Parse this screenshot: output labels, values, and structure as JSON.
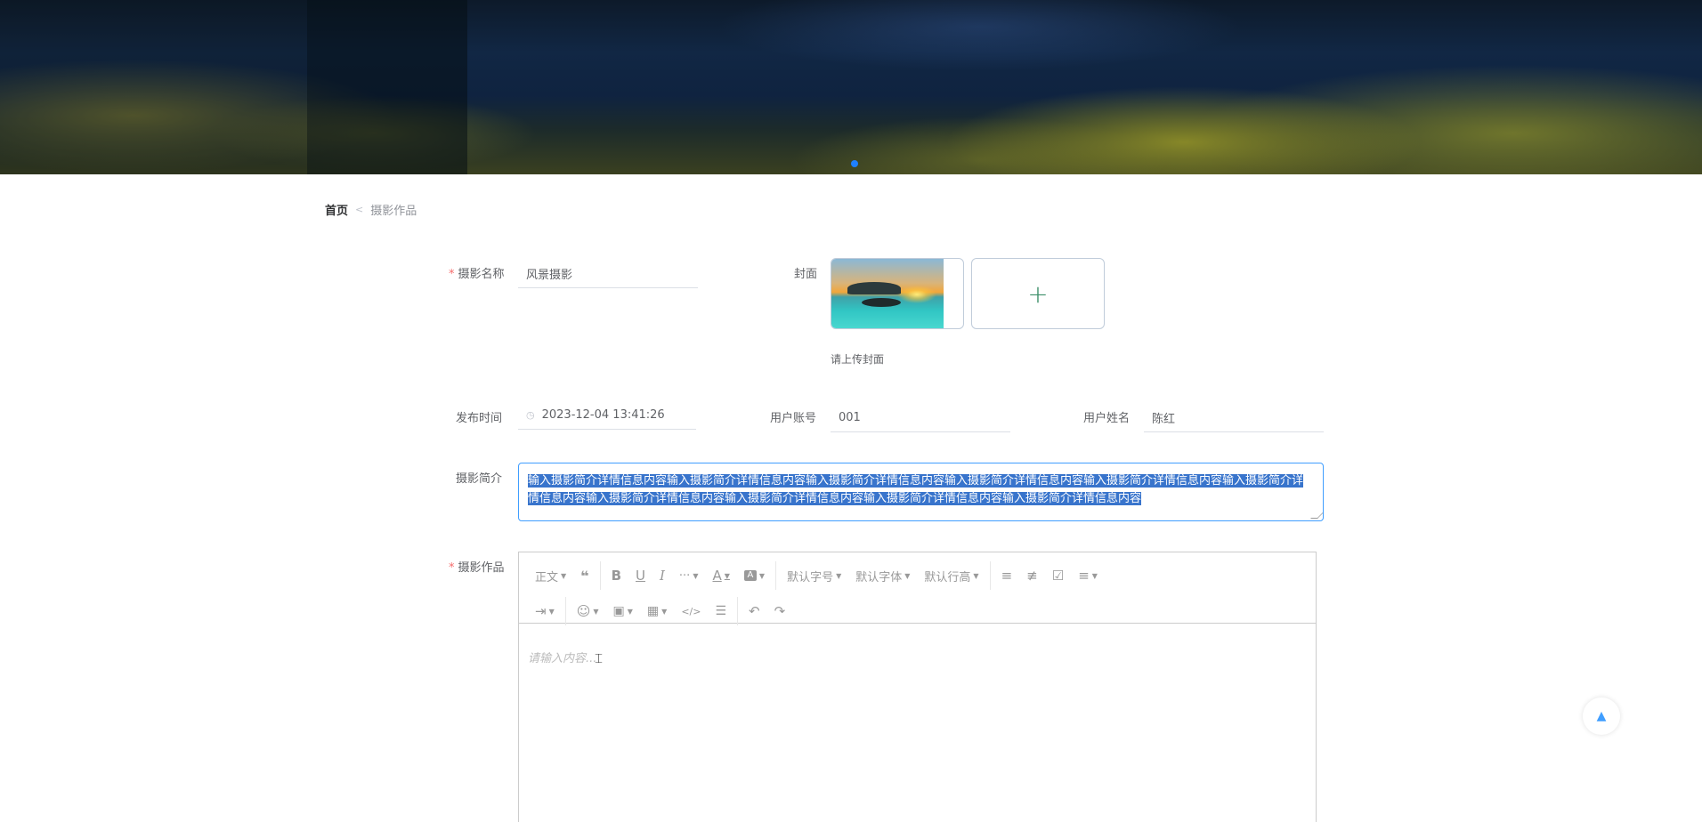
{
  "breadcrumb": {
    "home": "首页",
    "separator": "<",
    "current": "摄影作品"
  },
  "form": {
    "name_label": "摄影名称",
    "name_value": "风景摄影",
    "cover_label": "封面",
    "cover_tip": "请上传封面",
    "upload_plus": "+",
    "publish_time_label": "发布时间",
    "publish_time_value": "2023-12-04 13:41:26",
    "account_label": "用户账号",
    "account_value": "001",
    "username_label": "用户姓名",
    "username_value": "陈红",
    "intro_label": "摄影简介",
    "intro_value": "输入摄影简介详情信息内容输入摄影简介详情信息内容输入摄影简介详情信息内容输入摄影简介详情信息内容输入摄影简介详情信息内容输入摄影简介详情信息内容输入摄影简介详情信息内容输入摄影简介详情信息内容输入摄影简介详情信息内容输入摄影简介详情信息内容",
    "works_label": "摄影作品"
  },
  "editor": {
    "paragraph": "正文",
    "font_size": "默认字号",
    "font_family": "默认字体",
    "line_height": "默认行高",
    "placeholder": "请输入内容..."
  },
  "accent_color": "#409eff",
  "required_color": "#f56c6c"
}
